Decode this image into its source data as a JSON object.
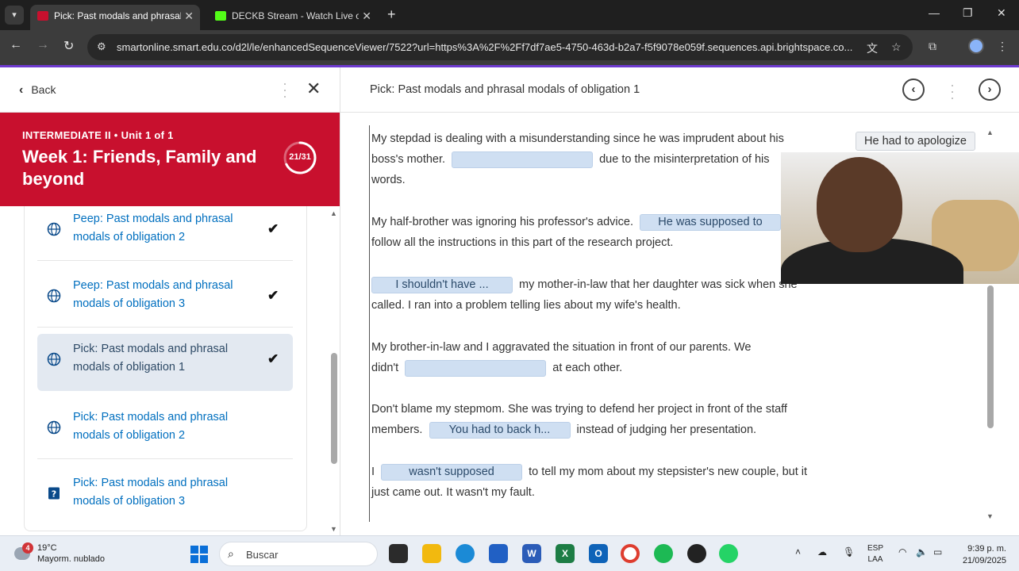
{
  "browser": {
    "tabs": [
      {
        "title": "Pick: Past modals and phrasal mod",
        "active": true
      },
      {
        "title": "DECKB Stream - Watch Live on",
        "active": false
      }
    ],
    "url": "smartonline.smart.edu.co/d2l/le/enhancedSequenceViewer/7522?url=https%3A%2F%2Ff7df7ae5-4750-463d-b2a7-f5f9078e059f.sequences.api.brightspace.co...",
    "accent_color": "#6e3ad0"
  },
  "sidebar": {
    "back_label": "Back",
    "course_crumb_level": "INTERMEDIATE II",
    "course_crumb_unit": "Unit 1 of 1",
    "unit_title": "Week 1: Friends, Family and beyond",
    "progress_text": "21/31",
    "progress_fraction": 0.677,
    "banner_color": "#c8102e",
    "items": [
      {
        "label": "Peep: Past modals and phrasal modals of obligation 2",
        "icon": "globe-icon",
        "done": true,
        "selected": false
      },
      {
        "label": "Peep: Past modals and phrasal modals of obligation 3",
        "icon": "globe-icon",
        "done": true,
        "selected": false
      },
      {
        "label": "Pick: Past modals and phrasal modals of obligation 1",
        "icon": "globe-icon",
        "done": true,
        "selected": true
      },
      {
        "label": "Pick: Past modals and phrasal modals of obligation 2",
        "icon": "globe-icon",
        "done": false,
        "selected": false
      },
      {
        "label": "Pick: Past modals and phrasal modals of obligation 3",
        "icon": "quiz-icon",
        "done": false,
        "selected": false
      }
    ]
  },
  "main": {
    "title": "Pick: Past modals and phrasal modals of obligation 1",
    "floating_choice": "He had to apologize",
    "paragraphs": [
      {
        "before": "My stepdad is dealing with a misunderstanding since he was imprudent about his boss's mother.",
        "blank": "",
        "after": "due to the misinterpretation of his words."
      },
      {
        "before": "My half-brother was ignoring his professor's advice.",
        "blank": "He was supposed to",
        "after": "follow all the instructions in this part of the research project."
      },
      {
        "before": "",
        "blank": "I shouldn't have ...",
        "after": "my mother-in-law that her daughter was sick when she called. I ran into a problem telling lies about my wife's health."
      },
      {
        "before": "My brother-in-law and I aggravated the situation in front of our parents. We didn't",
        "blank": "",
        "after": "at each other."
      },
      {
        "before": "Don't blame my stepmom. She was trying to defend her project in front of the staff members.",
        "blank": "You had to back h...",
        "after": "instead of judging her presentation."
      },
      {
        "before": "I",
        "blank": "wasn't supposed",
        "after": "to tell my mom about my stepsister's new couple, but it just came out. It wasn't my fault."
      }
    ]
  },
  "taskbar": {
    "weather_badge": "4",
    "weather_temp": "19°C",
    "weather_condition": "Mayorm. nublado",
    "search_placeholder": "Buscar",
    "lang_top": "ESP",
    "lang_bottom": "LAA",
    "time": "9:39 p. m.",
    "date": "21/09/2025"
  }
}
